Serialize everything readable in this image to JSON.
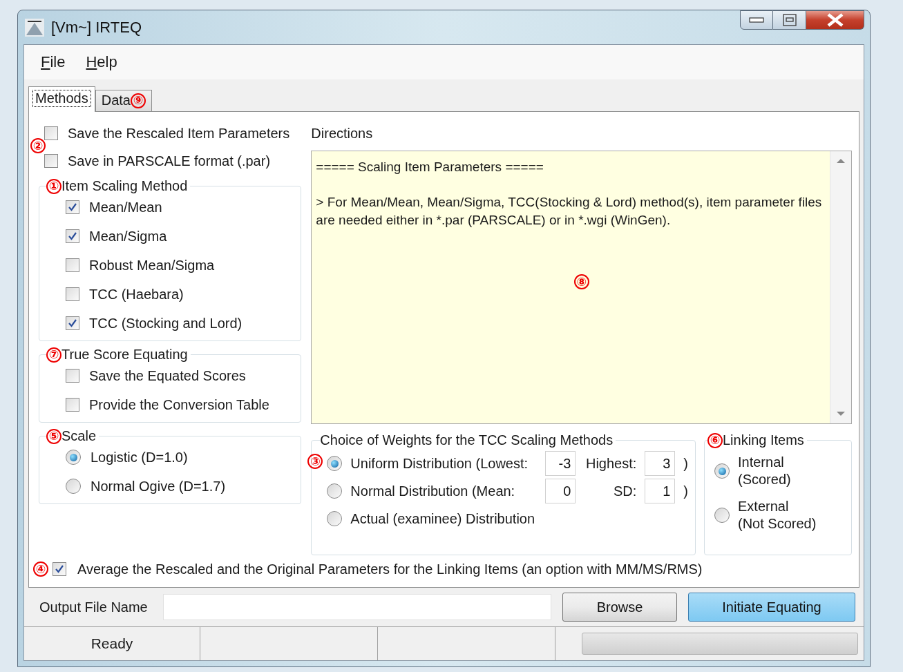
{
  "window": {
    "title": "[Vm~] IRTEQ"
  },
  "menu": [
    {
      "label": "File"
    },
    {
      "label": "Help"
    }
  ],
  "tabs": [
    {
      "label": "Methods",
      "selected": true
    },
    {
      "label": "Data",
      "selected": false,
      "marker": "⑨"
    }
  ],
  "save_options": {
    "marker": "②",
    "items": [
      {
        "label": "Save the Rescaled Item Parameters",
        "checked": false
      },
      {
        "label": "Save in PARSCALE format (.par)",
        "checked": false
      }
    ]
  },
  "item_scaling_method": {
    "marker": "①",
    "title": "Item Scaling Method",
    "items": [
      {
        "label": "Mean/Mean",
        "checked": true
      },
      {
        "label": "Mean/Sigma",
        "checked": true
      },
      {
        "label": "Robust Mean/Sigma",
        "checked": false
      },
      {
        "label": "TCC (Haebara)",
        "checked": false
      },
      {
        "label": "TCC (Stocking and Lord)",
        "checked": true
      }
    ]
  },
  "true_score_equating": {
    "marker": "⑦",
    "title": "True Score Equating",
    "items": [
      {
        "label": "Save the Equated Scores",
        "checked": false
      },
      {
        "label": "Provide the Conversion Table",
        "checked": false
      }
    ]
  },
  "scale": {
    "marker": "⑤",
    "title": "Scale",
    "options": [
      {
        "label": "Logistic (D=1.0)",
        "selected": true
      },
      {
        "label": "Normal Ogive (D=1.7)",
        "selected": false
      }
    ]
  },
  "directions": {
    "label": "Directions",
    "marker": "⑧",
    "paragraphs": [
      "===== Scaling Item Parameters =====",
      "> For Mean/Mean, Mean/Sigma, TCC(Stocking & Lord) method(s), item parameter files are needed either in *.par (PARSCALE) or in *.wgi (WinGen)."
    ]
  },
  "weights": {
    "marker": "③",
    "title": "Choice of Weights for the TCC Scaling Methods",
    "options": [
      {
        "label": "Uniform Distribution (Lowest:",
        "selected": true,
        "value_1": "-3",
        "label_2": "Highest:",
        "value_2": "3",
        "close": ")"
      },
      {
        "label": "Normal Distribution  (Mean:",
        "selected": false,
        "value_1": "0",
        "label_2": "SD:",
        "value_2": "1",
        "close": ")"
      },
      {
        "label": "Actual (examinee) Distribution",
        "selected": false
      }
    ]
  },
  "linking_items": {
    "marker": "⑥",
    "title": "Linking Items",
    "options": [
      {
        "lines": [
          "Internal",
          "(Scored)"
        ],
        "selected": true
      },
      {
        "lines": [
          "External",
          "(Not Scored)"
        ],
        "selected": false
      }
    ]
  },
  "average_option": {
    "marker": "④",
    "label": "Average the Rescaled and the Original Parameters for the Linking Items (an option with MM/MS/RMS)",
    "checked": true
  },
  "output": {
    "label": "Output File Name"
  },
  "buttons": [
    {
      "label": "Browse",
      "kind": "normal"
    },
    {
      "label": "Initiate Equating",
      "kind": "highlighted"
    }
  ],
  "status_bar": {
    "text": "Ready",
    "progress": {
      "level": 0
    }
  }
}
